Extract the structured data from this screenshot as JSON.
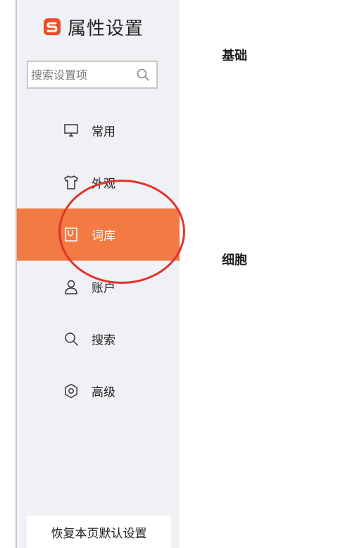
{
  "app": {
    "title": "属性设置",
    "brand_color": "#f47a43"
  },
  "search": {
    "placeholder": "搜索设置项",
    "icon": "search-icon"
  },
  "nav": {
    "items": [
      {
        "id": "general",
        "label": "常用",
        "icon": "monitor-icon",
        "active": false
      },
      {
        "id": "appearance",
        "label": "外观",
        "icon": "shirt-icon",
        "active": false
      },
      {
        "id": "dictionary",
        "label": "词库",
        "icon": "book-icon",
        "active": true
      },
      {
        "id": "account",
        "label": "账户",
        "icon": "user-icon",
        "active": false
      },
      {
        "id": "search",
        "label": "搜索",
        "icon": "search-icon",
        "active": false
      },
      {
        "id": "advanced",
        "label": "高级",
        "icon": "gear-icon",
        "active": false
      }
    ],
    "active_color": "#f47a43"
  },
  "footer": {
    "reset_label": "恢复本页默认设置"
  },
  "content": {
    "sections": [
      {
        "heading": "基础"
      },
      {
        "heading": "细胞"
      }
    ]
  },
  "annotation": {
    "color": "#e0332c"
  }
}
